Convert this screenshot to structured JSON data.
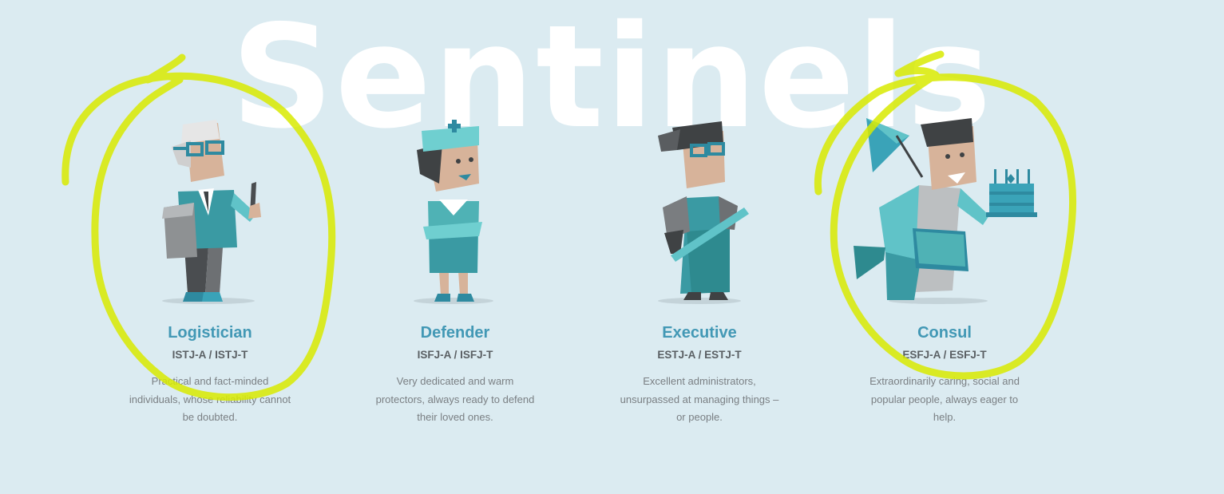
{
  "group": {
    "title": "Sentinels"
  },
  "personalities": [
    {
      "name": "Logistician",
      "code": "ISTJ-A / ISTJ-T",
      "description": "Practical and fact-minded individuals, whose reliability cannot be doubted."
    },
    {
      "name": "Defender",
      "code": "ISFJ-A / ISFJ-T",
      "description": "Very dedicated and warm protectors, always ready to defend their loved ones."
    },
    {
      "name": "Executive",
      "code": "ESTJ-A / ESTJ-T",
      "description": "Excellent administrators, unsurpassed at managing things – or people."
    },
    {
      "name": "Consul",
      "code": "ESFJ-A / ESFJ-T",
      "description": "Extraordinarily caring, social and popular people, always eager to help."
    }
  ],
  "colors": {
    "background": "#dbebf1",
    "title": "#ffffff",
    "name": "#4298b5",
    "code": "#5a5f63",
    "description": "#7a7f83",
    "highlight_marker": "#d8ea00"
  }
}
